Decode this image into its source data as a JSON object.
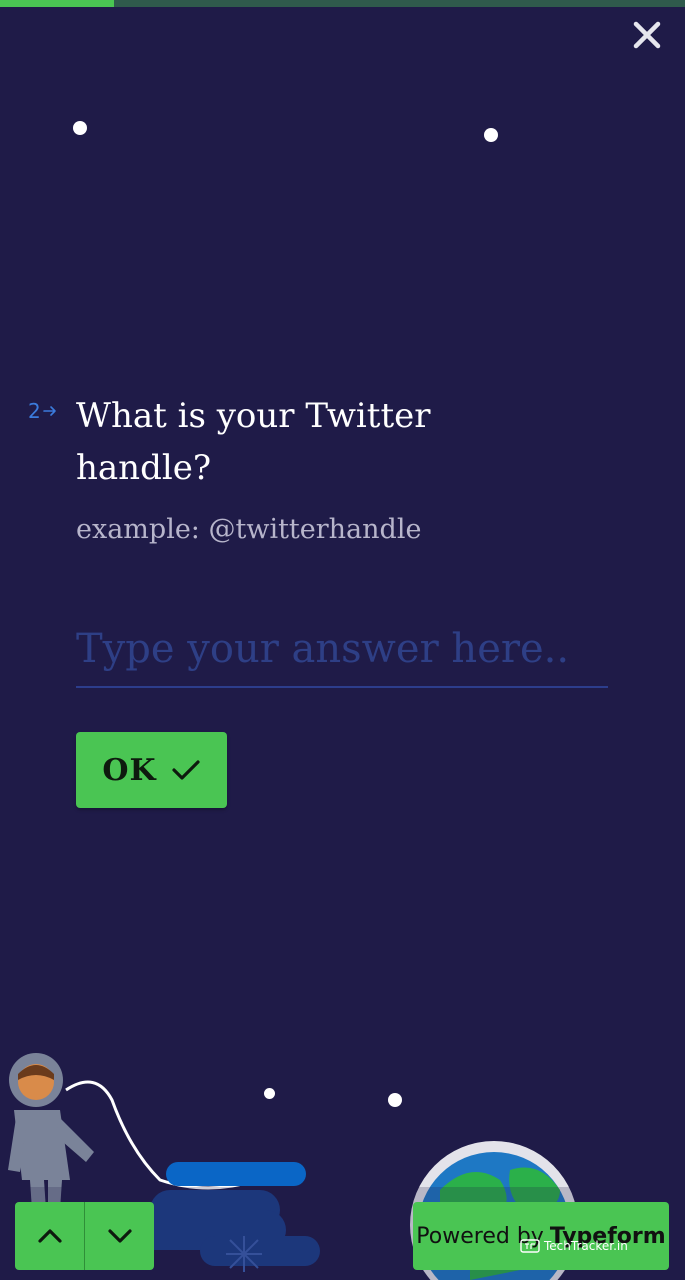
{
  "progress": {
    "fraction": 0.167,
    "track_color": "#2f5a4c",
    "fill_color": "#4ac553"
  },
  "close_icon": "close-icon",
  "question": {
    "number": "2",
    "arrow_icon": "arrow-right-icon",
    "title": "What is your Twitter handle?",
    "description": "example: @twitterhandle"
  },
  "answer": {
    "placeholder": "Type your answer here.."
  },
  "ok_button": {
    "label": "OK",
    "icon": "checkmark-icon"
  },
  "navigation": {
    "up_icon": "chevron-up-icon",
    "down_icon": "chevron-down-icon"
  },
  "powered_by": {
    "prefix": "Powered by",
    "brand": "Typeform"
  },
  "watermark": {
    "text": "TechTracker.in"
  },
  "colors": {
    "background": "#1f1b48",
    "accent_green": "#4ac553",
    "question_number": "#3b7bdc",
    "placeholder": "#2e3f86"
  }
}
